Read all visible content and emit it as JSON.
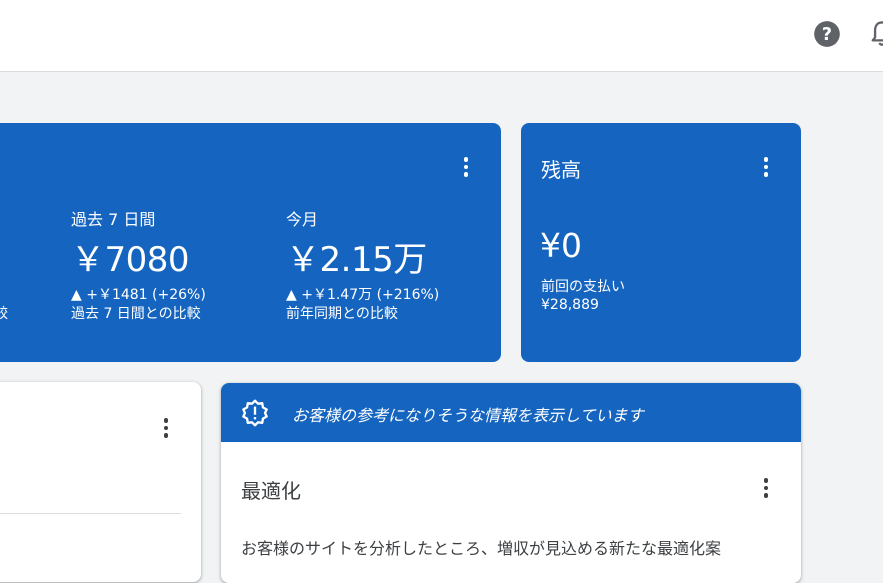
{
  "header": {
    "help_icon": "help-circle-icon",
    "notifications_icon": "bell-icon"
  },
  "earnings": {
    "left_compare_partial": "比較",
    "last_7_days": {
      "label": "過去 7 日間",
      "value": "￥7080",
      "delta": "▲ +￥1481 (+26%)",
      "compare": "過去 7 日間との比較"
    },
    "this_month": {
      "label": "今月",
      "value": "￥2.15万",
      "delta": "▲ +￥1.47万 (+216%)",
      "compare": "前年同期との比較"
    }
  },
  "balance": {
    "title": "残高",
    "value": "¥0",
    "last_payment_label": "前回の支払い",
    "last_payment_amount": "¥28,889"
  },
  "insights": {
    "banner_text": "お客様の参考になりそうな情報を表示しています",
    "title": "最適化",
    "body": "お客様のサイトを分析したところ、増収が見込める新たな最適化案"
  },
  "colors": {
    "card_blue": "#1565c0",
    "topbar": "#ffffff",
    "background": "#f1f3f4"
  }
}
